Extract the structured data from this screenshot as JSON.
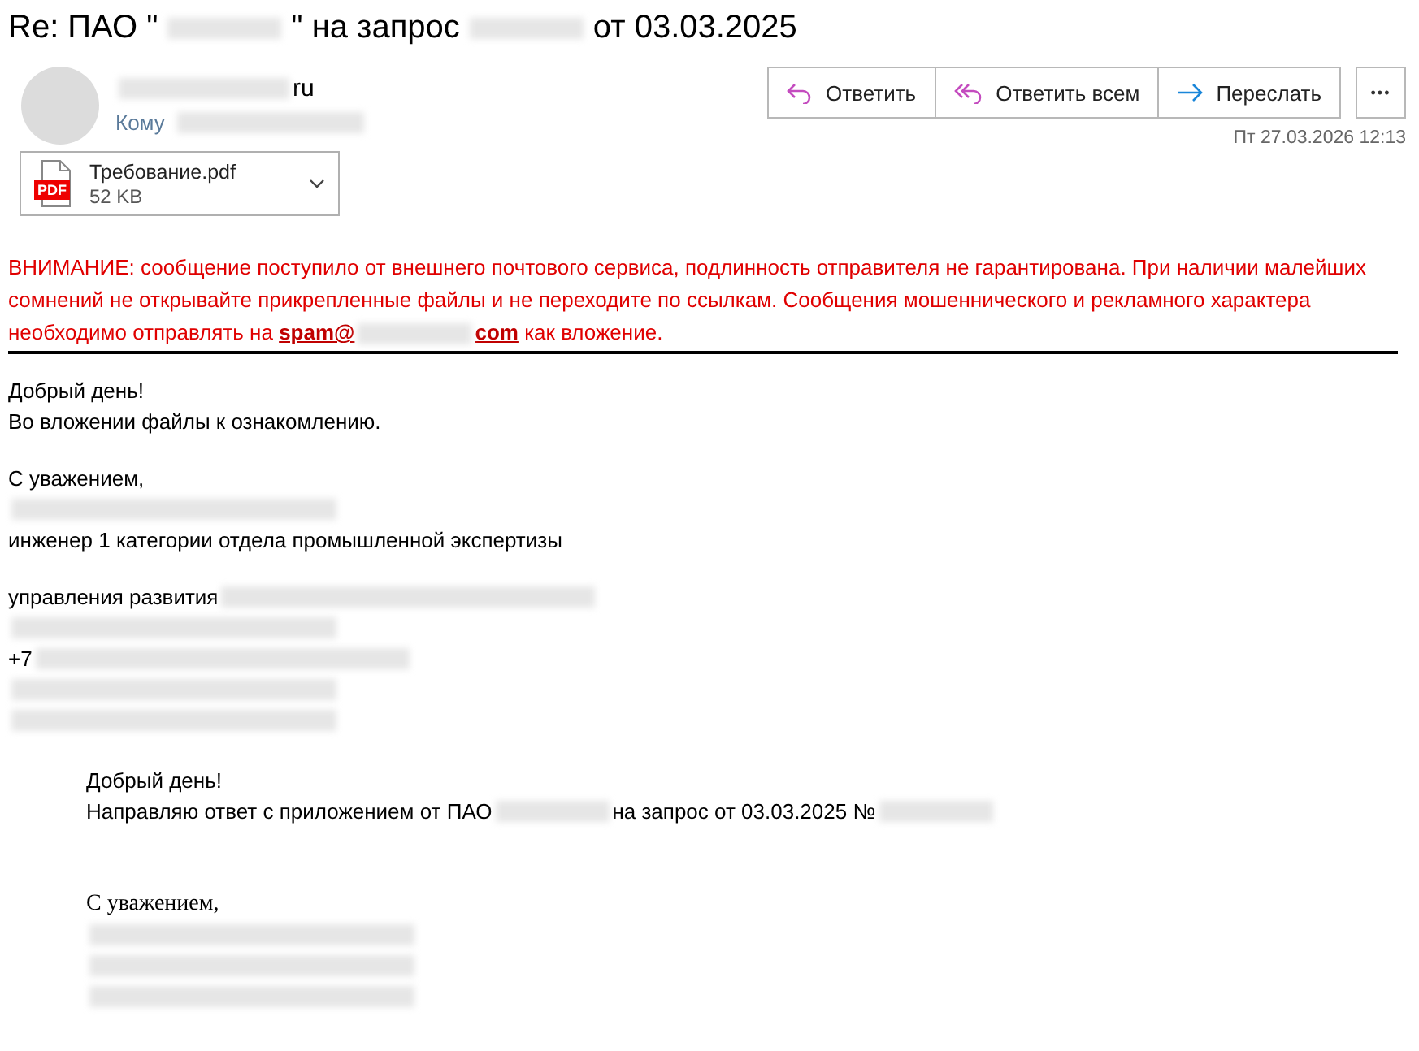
{
  "subject": [
    {
      "kind": "text",
      "text": "Re: ПАО \""
    },
    {
      "kind": "redacted"
    },
    {
      "kind": "text",
      "text": "\" на запрос"
    },
    {
      "kind": "redacted"
    },
    {
      "kind": "text",
      "text": "от 03.03.2025"
    }
  ],
  "sender": {
    "address": [
      {
        "kind": "redacted"
      },
      {
        "kind": "text",
        "text": "ru"
      }
    ],
    "to_label": "Кому",
    "to": [
      {
        "kind": "redacted"
      }
    ]
  },
  "actions": [
    {
      "kind": "reply",
      "label": "Ответить"
    },
    {
      "kind": "reply_all",
      "label": "Ответить всем"
    },
    {
      "kind": "forward",
      "label": "Переслать"
    }
  ],
  "more": "•••",
  "date": "Пт 27.03.2026 12:13",
  "attachment": {
    "badge": "PDF",
    "name": "Требование.pdf",
    "size": "52 KB"
  },
  "warning": [
    {
      "kind": "text",
      "text": "ВНИМАНИЕ: сообщение поступило от внешнего почтового сервиса, подлинность отправителя не гарантирована. При наличии малейших сомнений не открывайте прикрепленные файлы и не переходите по ссылкам. Сообщения мошеннического и рекламного характера необходимо отправлять на "
    },
    {
      "kind": "link",
      "text": "spam@"
    },
    {
      "kind": "redacted"
    },
    {
      "kind": "link",
      "text": "com"
    },
    {
      "kind": "text",
      "text": " как вложение."
    }
  ],
  "body": [
    [
      [
        {
          "kind": "text",
          "text": "Добрый день!"
        }
      ],
      [
        {
          "kind": "text",
          "text": "Во вложении файлы к ознакомлению."
        }
      ]
    ],
    [
      [
        {
          "kind": "text",
          "text": "С уважением,"
        }
      ],
      [
        {
          "kind": "redacted"
        }
      ],
      [
        {
          "kind": "text",
          "text": "инженер 1 категории отдела промышленной экспертизы"
        }
      ]
    ],
    [
      [
        {
          "kind": "text",
          "text": "управления развития"
        },
        {
          "kind": "redacted"
        }
      ],
      [
        {
          "kind": "redacted"
        }
      ],
      [
        {
          "kind": "text",
          "text": "+7"
        },
        {
          "kind": "redacted"
        }
      ],
      [
        {
          "kind": "redacted"
        }
      ],
      [
        {
          "kind": "redacted"
        }
      ]
    ]
  ],
  "quote": [
    [
      [
        {
          "kind": "text",
          "text": "Добрый день!"
        }
      ],
      [
        {
          "kind": "text",
          "text": "Направляю ответ с приложением от ПАО"
        },
        {
          "kind": "redacted"
        },
        {
          "kind": "text",
          "text": "на запрос от 03.03.2025 №"
        },
        {
          "kind": "redacted"
        }
      ]
    ],
    [
      [
        {
          "kind": "serif",
          "text": "С уважением,"
        }
      ],
      [
        {
          "kind": "redacted"
        }
      ],
      [
        {
          "kind": "redacted"
        }
      ],
      [
        {
          "kind": "redacted"
        }
      ]
    ]
  ]
}
